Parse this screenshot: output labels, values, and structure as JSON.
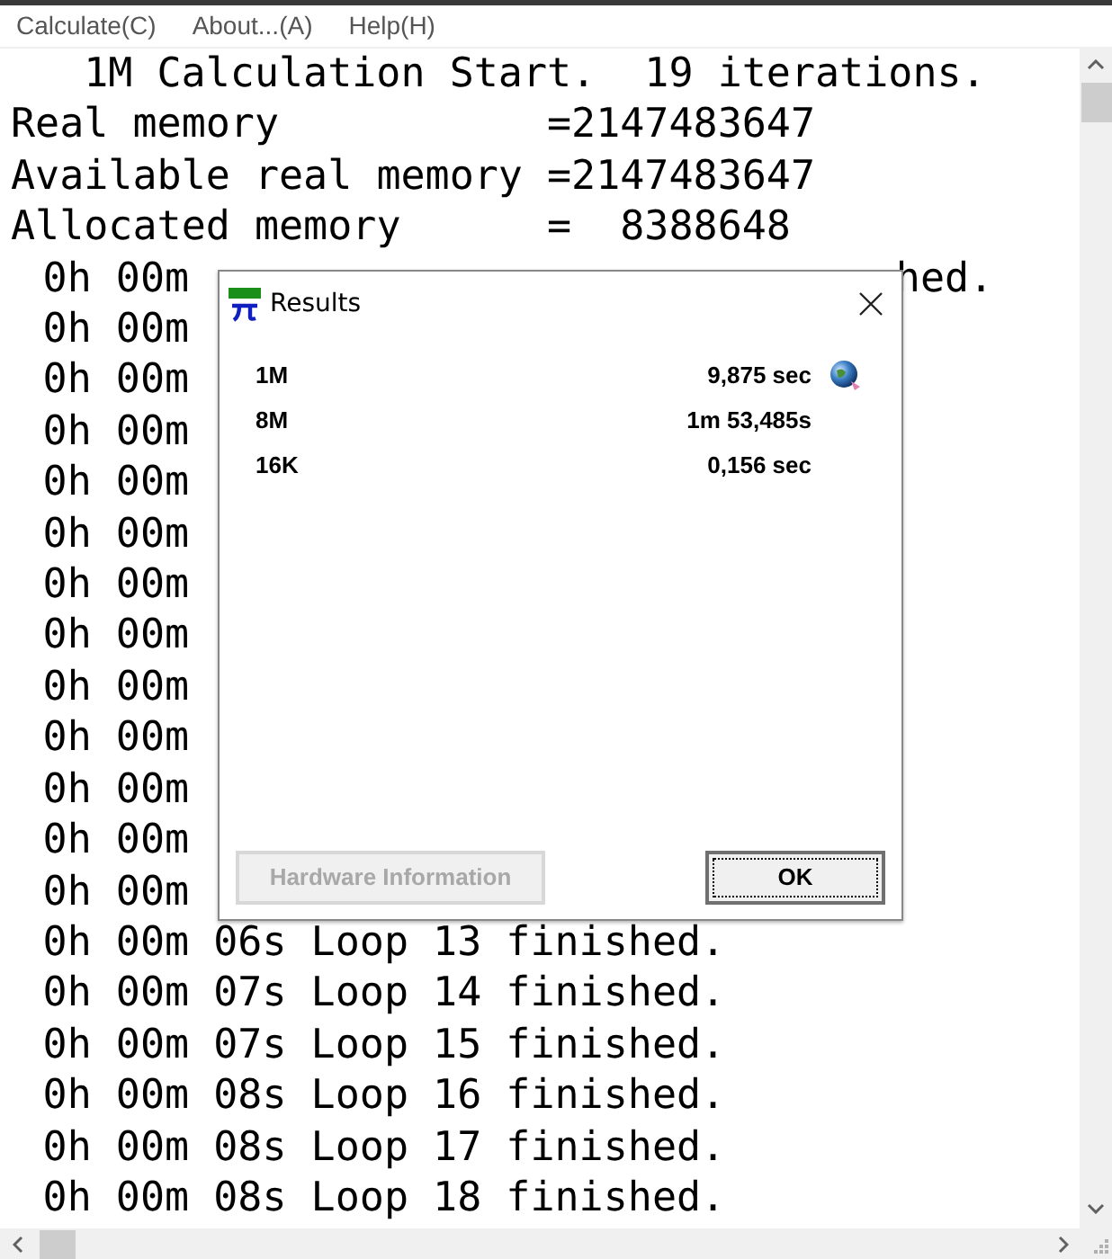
{
  "menu": [
    "Calculate(C)",
    "About...(A)",
    "Help(H)"
  ],
  "log": {
    "header": "1M Calculation Start.  19 iterations.",
    "memory": [
      {
        "label": "Real memory",
        "value": "=2147483647"
      },
      {
        "label": "Available real memory",
        "value": "=2147483647"
      },
      {
        "label": "Allocated memory",
        "value": "=  8388648"
      }
    ],
    "lines": [
      {
        "kind": "partial",
        "left": "0h 00m",
        "right": "hed."
      },
      {
        "kind": "partial",
        "left": "0h 00m"
      },
      {
        "kind": "partial",
        "left": "0h 00m"
      },
      {
        "kind": "partial",
        "left": "0h 00m"
      },
      {
        "kind": "partial",
        "left": "0h 00m"
      },
      {
        "kind": "partial",
        "left": "0h 00m"
      },
      {
        "kind": "partial",
        "left": "0h 00m"
      },
      {
        "kind": "partial",
        "left": "0h 00m"
      },
      {
        "kind": "partial",
        "left": "0h 00m"
      },
      {
        "kind": "partial",
        "left": "0h 00m"
      },
      {
        "kind": "partial",
        "left": "0h 00m"
      },
      {
        "kind": "partial",
        "left": "0h 00m"
      },
      {
        "kind": "partial",
        "left": "0h 00m"
      },
      {
        "kind": "full",
        "text": "0h 00m 06s Loop 13 finished."
      },
      {
        "kind": "full",
        "text": "0h 00m 07s Loop 14 finished."
      },
      {
        "kind": "full",
        "text": "0h 00m 07s Loop 15 finished."
      },
      {
        "kind": "full",
        "text": "0h 00m 08s Loop 16 finished."
      },
      {
        "kind": "full",
        "text": "0h 00m 08s Loop 17 finished."
      },
      {
        "kind": "full",
        "text": "0h 00m 08s Loop 18 finished."
      }
    ]
  },
  "dialog": {
    "title": "Results",
    "results": [
      {
        "label": "1M",
        "time": "9,875 sec",
        "globe": true
      },
      {
        "label": "8M",
        "time": "1m 53,485s",
        "globe": false
      },
      {
        "label": "16K",
        "time": "0,156 sec",
        "globe": false
      }
    ],
    "buttons": [
      {
        "label": "Hardware Information",
        "disabled": true,
        "focused": false
      },
      {
        "label": "OK",
        "disabled": false,
        "focused": true
      }
    ]
  }
}
